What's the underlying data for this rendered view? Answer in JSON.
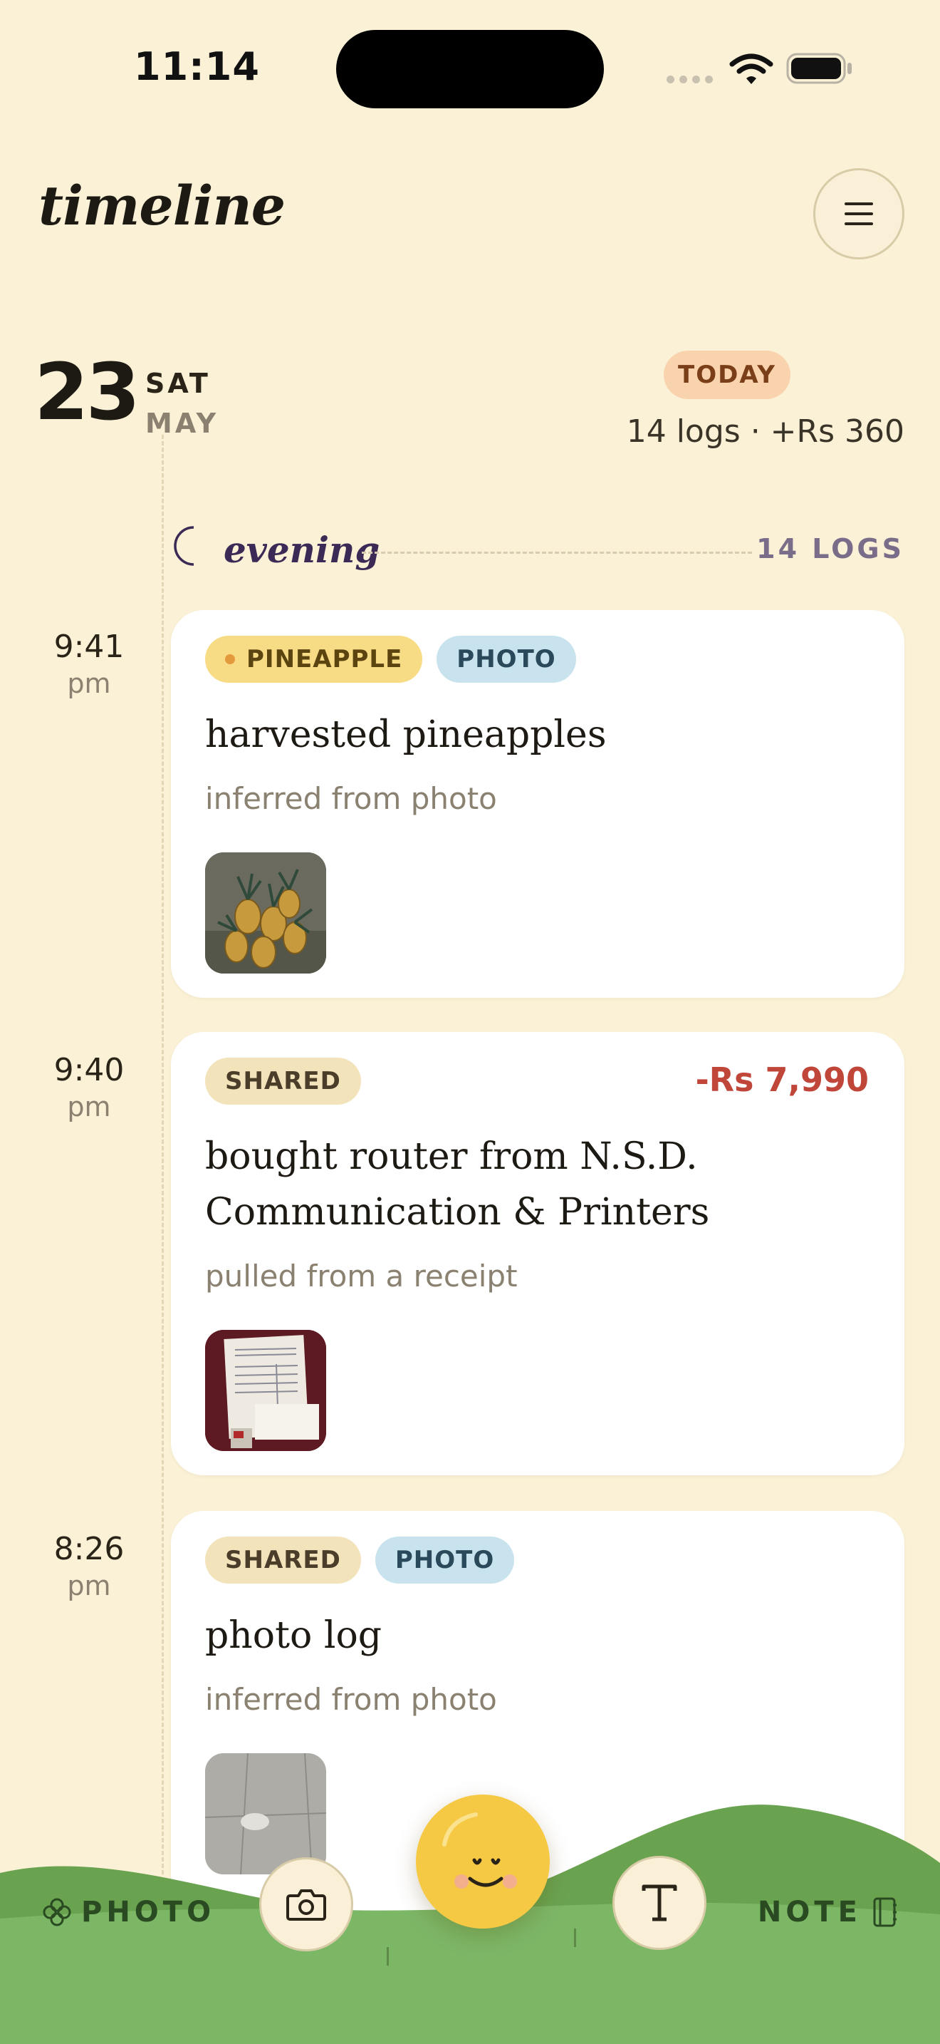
{
  "status_bar": {
    "time": "11:14"
  },
  "header": {
    "title": "timeline"
  },
  "day": {
    "date": "23",
    "weekday": "SAT",
    "month": "MAY",
    "badge": "TODAY",
    "summary": "14 logs · +Rs 360"
  },
  "section": {
    "label": "evening",
    "count": "14 LOGS"
  },
  "entries": [
    {
      "time": "9:41",
      "ampm": "pm",
      "tags": [
        "PINEAPPLE",
        "PHOTO"
      ],
      "title": "harvested pineapples",
      "subtitle": "inferred from photo",
      "amount": ""
    },
    {
      "time": "9:40",
      "ampm": "pm",
      "tags": [
        "SHARED"
      ],
      "title": "bought router from N.S.D. Communication & Printers",
      "subtitle": "pulled from a receipt",
      "amount": "-Rs 7,990"
    },
    {
      "time": "8:26",
      "ampm": "pm",
      "tags": [
        "SHARED",
        "PHOTO"
      ],
      "title": "photo log",
      "subtitle": "inferred from photo",
      "amount": ""
    }
  ],
  "bottom_nav": {
    "photo_label": "PHOTO",
    "note_label": "NOTE"
  },
  "colors": {
    "background": "#faf1d6",
    "card": "#ffffff",
    "expense": "#c0463a",
    "grass": "#7ab565",
    "mood": "#f6c945"
  },
  "icons": [
    "wifi-icon",
    "battery-icon",
    "menu-icon",
    "moon-icon",
    "camera-icon",
    "text-icon",
    "flower-icon",
    "notebook-icon",
    "smiley-icon"
  ]
}
